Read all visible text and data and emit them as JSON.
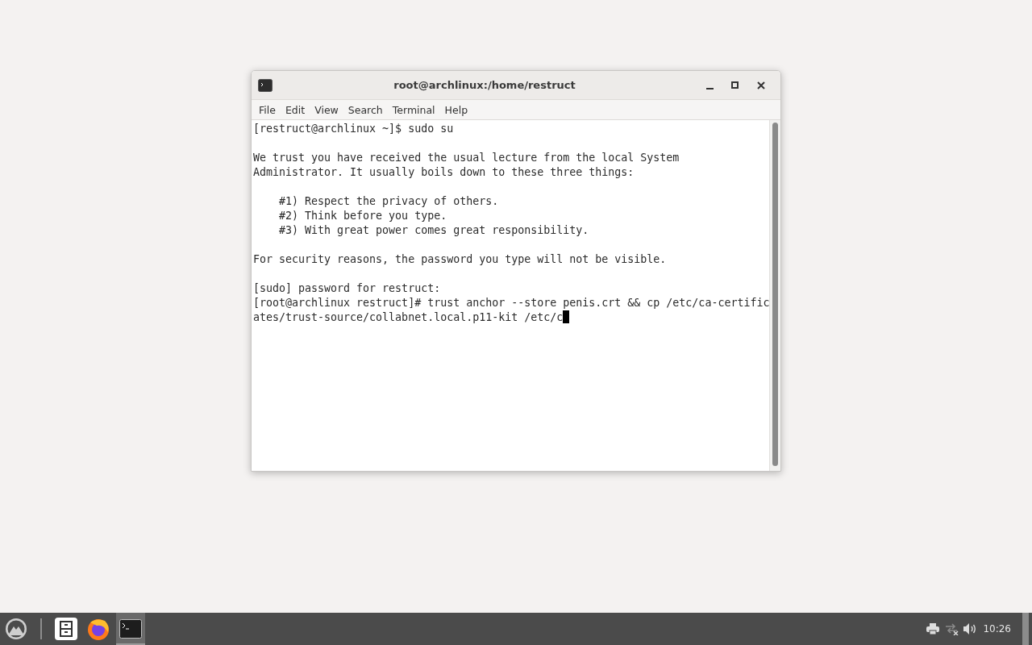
{
  "window": {
    "title": "root@archlinux:/home/restruct"
  },
  "menu": [
    "File",
    "Edit",
    "View",
    "Search",
    "Terminal",
    "Help"
  ],
  "terminal": {
    "paragraphs": [
      [
        "[restruct@archlinux ~]$ sudo su"
      ],
      [
        "We trust you have received the usual lecture from the local System",
        "Administrator. It usually boils down to these three things:"
      ],
      [
        "    #1) Respect the privacy of others.",
        "    #2) Think before you type.",
        "    #3) With great power comes great responsibility."
      ],
      [
        "For security reasons, the password you type will not be visible."
      ],
      [
        "[sudo] password for restruct:",
        "[root@archlinux restruct]# trust anchor --store penis.crt && cp /etc/ca-certific",
        "ates/trust-source/collabnet.local.p11-kit /etc/c"
      ]
    ],
    "cursor": true
  },
  "taskbar": {
    "items": [
      {
        "kind": "files",
        "active": false
      },
      {
        "kind": "browser",
        "active": false
      },
      {
        "kind": "terminal",
        "active": true
      }
    ],
    "clock": "10:26"
  }
}
